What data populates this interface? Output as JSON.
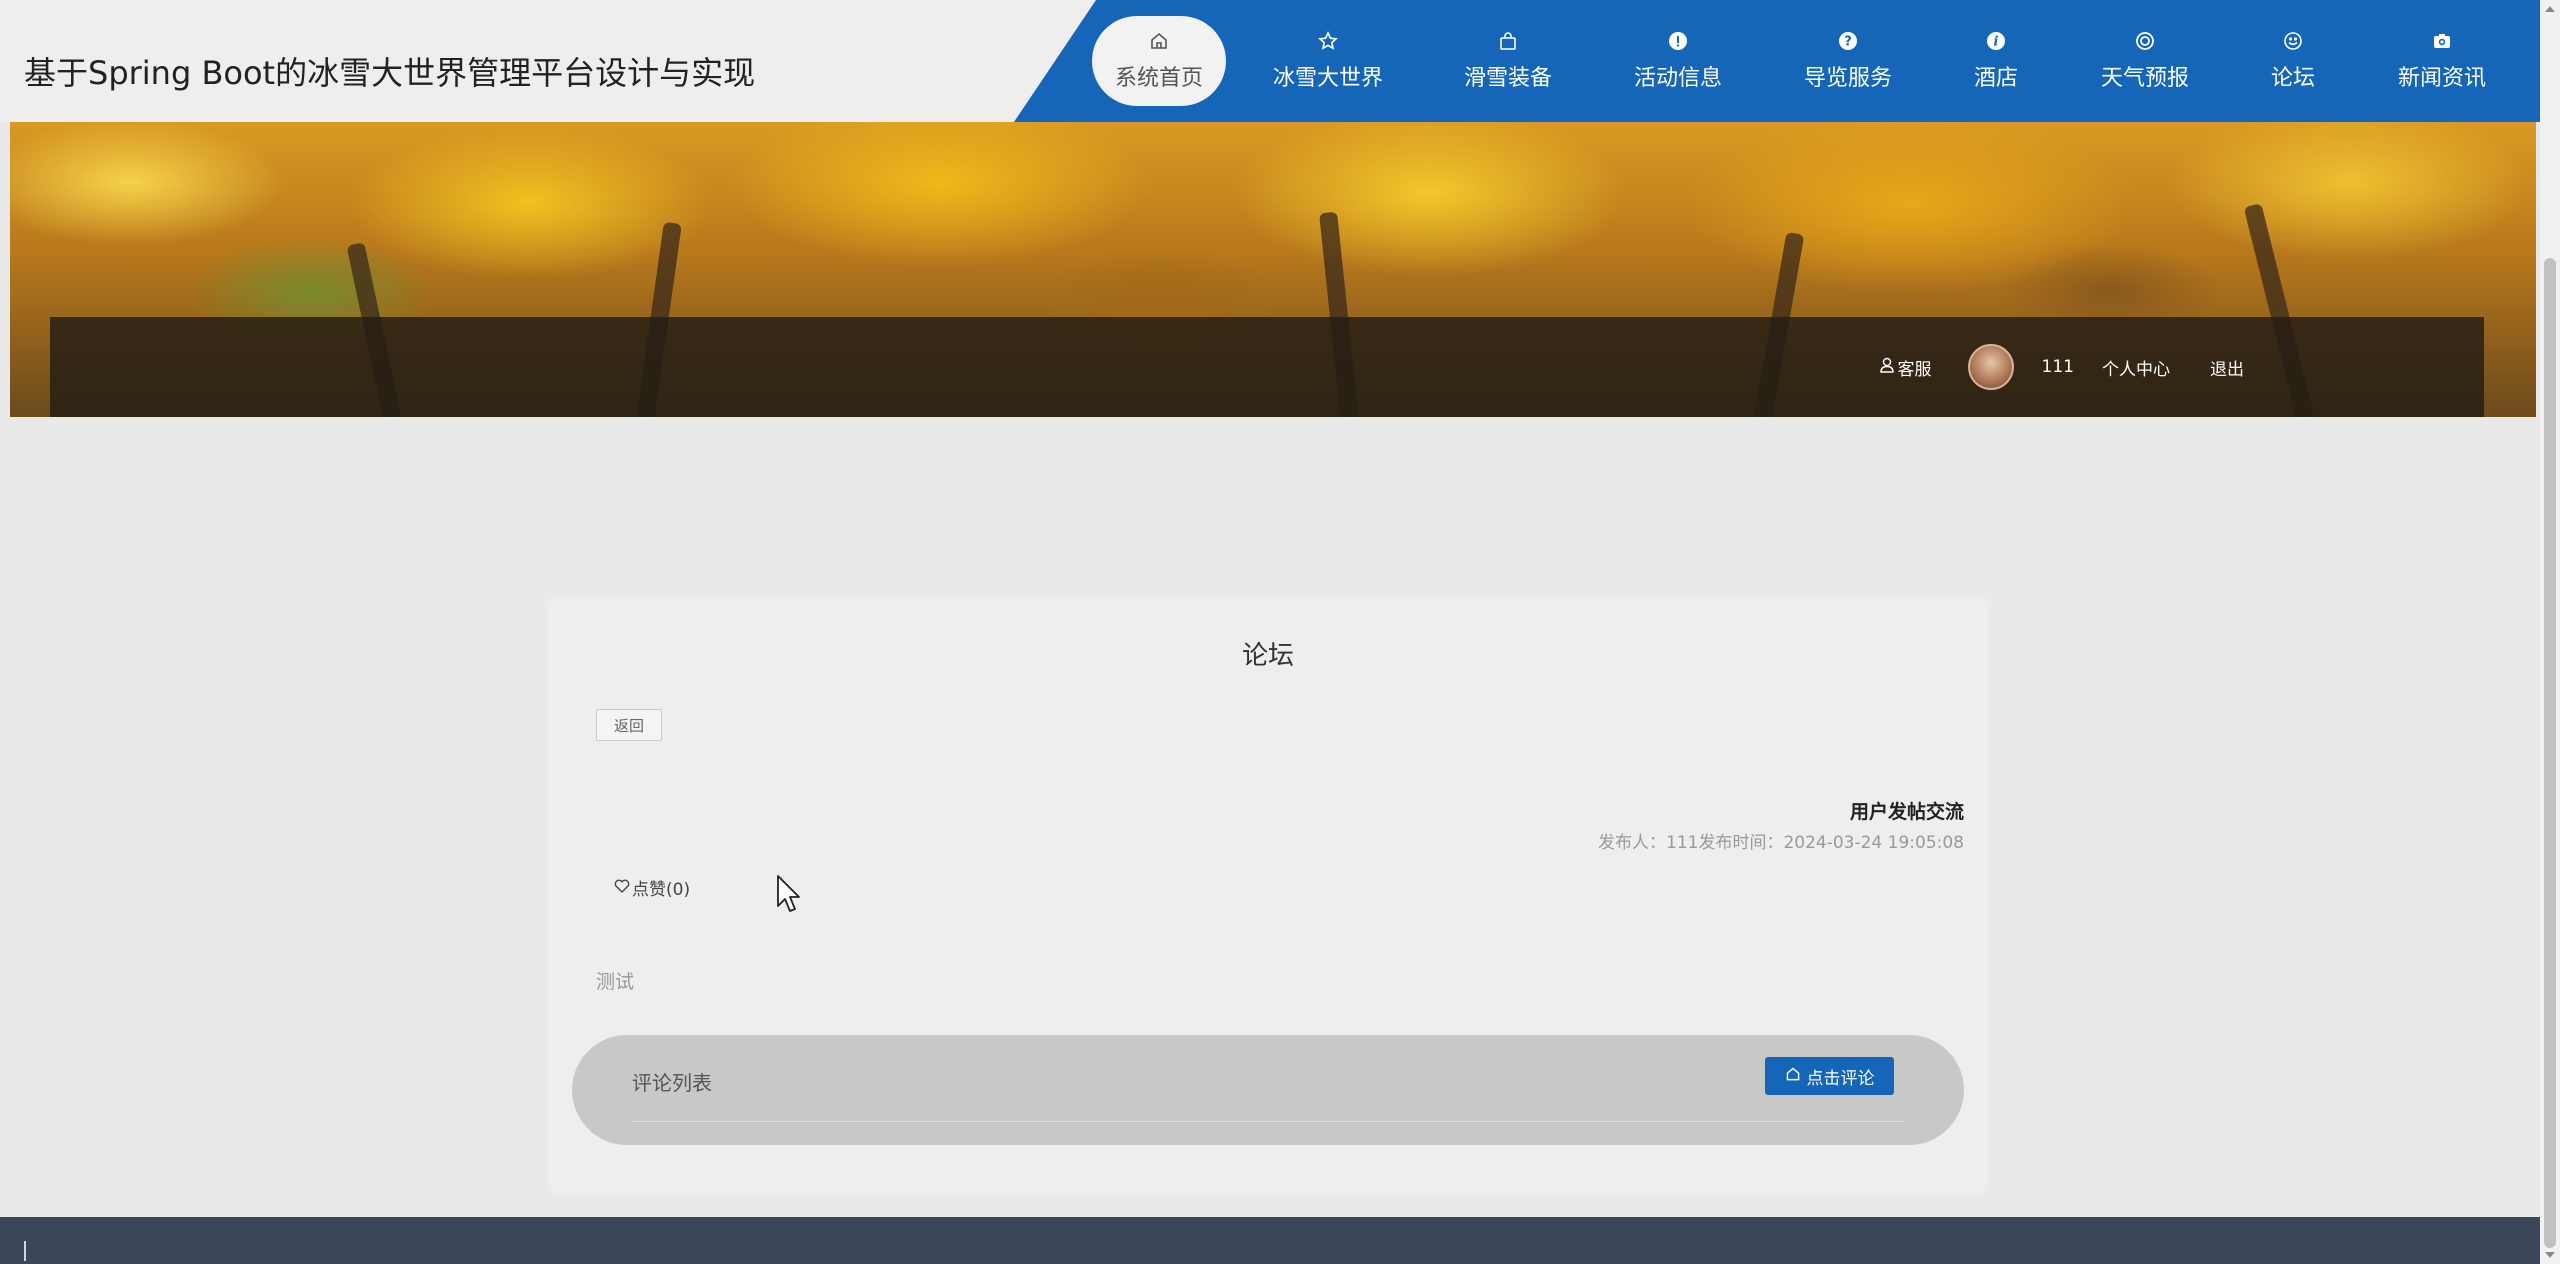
{
  "site": {
    "title": "基于Spring Boot的冰雪大世界管理平台设计与实现"
  },
  "nav": {
    "items": [
      {
        "label": "系统首页",
        "icon": "home-icon",
        "active": true
      },
      {
        "label": "冰雪大世界",
        "icon": "star-icon",
        "active": false
      },
      {
        "label": "滑雪装备",
        "icon": "bag-icon",
        "active": false
      },
      {
        "label": "活动信息",
        "icon": "alert-icon",
        "active": false
      },
      {
        "label": "导览服务",
        "icon": "question-icon",
        "active": false
      },
      {
        "label": "酒店",
        "icon": "info-icon",
        "active": false
      },
      {
        "label": "天气预报",
        "icon": "ring-icon",
        "active": false
      },
      {
        "label": "论坛",
        "icon": "smile-icon",
        "active": false
      },
      {
        "label": "新闻资讯",
        "icon": "camera-icon",
        "active": false
      }
    ]
  },
  "userbar": {
    "service": "客服",
    "username": "111",
    "center": "个人中心",
    "logout": "退出"
  },
  "card": {
    "title": "论坛",
    "back": "返回",
    "post_title": "用户发帖交流",
    "meta": "发布人：111发布时间：2024-03-24 19:05:08",
    "like": "点赞(0)",
    "body": "测试",
    "comments_label": "评论列表",
    "comment_button": "点击评论"
  },
  "colors": {
    "primary": "#1565b8",
    "footer": "#3b4658",
    "page_bg": "#e9e9e9"
  }
}
